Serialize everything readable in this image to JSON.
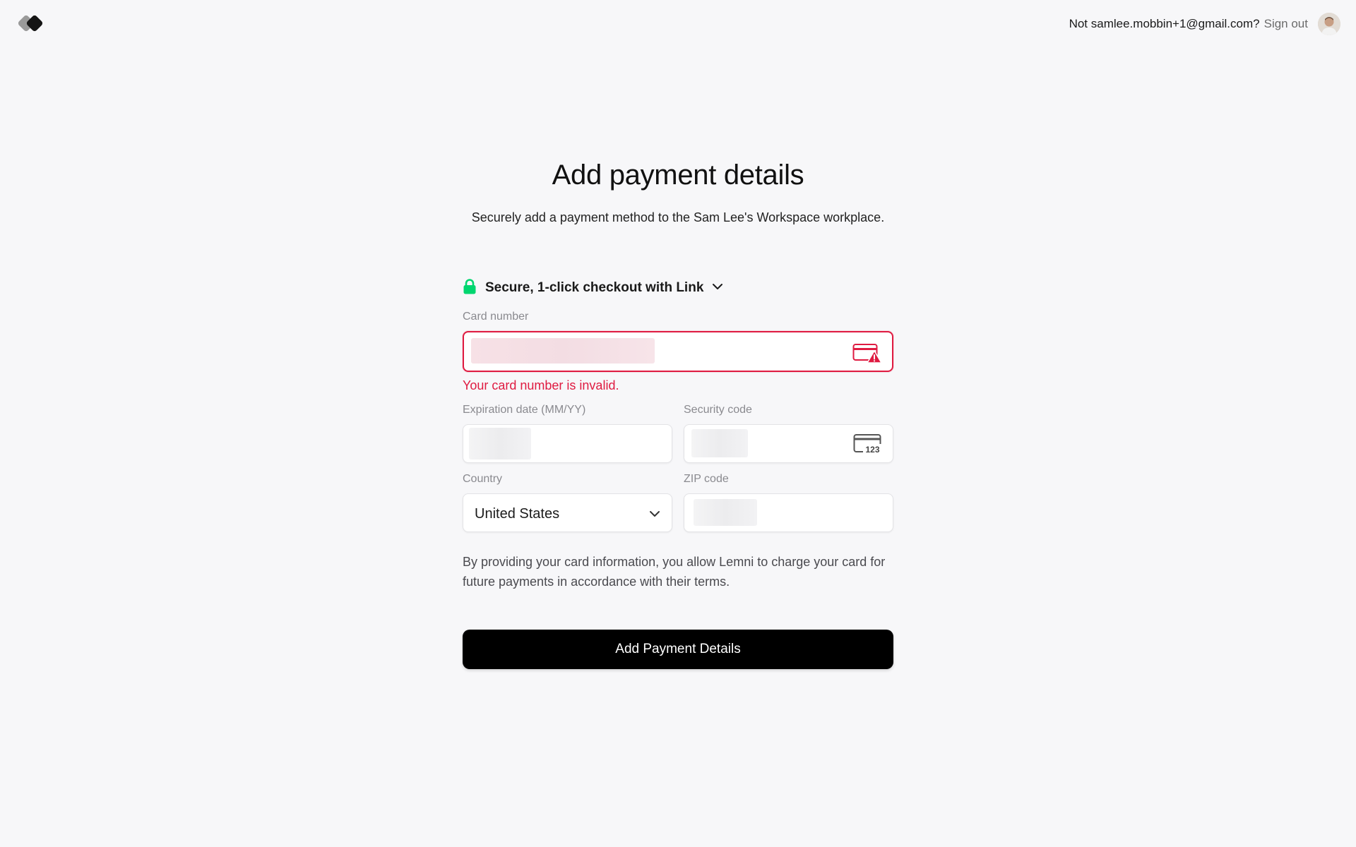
{
  "header": {
    "logo_icon": "brand-logo",
    "not_user_text": "Not samlee.mobbin+1@gmail.com?",
    "sign_out_label": "Sign out",
    "avatar_icon": "user-avatar"
  },
  "main": {
    "title": "Add payment details",
    "subtitle": "Securely add a payment method to the Sam Lee's Workspace workplace."
  },
  "payment_form": {
    "link_checkout": {
      "label": "Secure, 1-click checkout with Link",
      "lock_icon": "lock-icon",
      "chevron_icon": "chevron-down-icon",
      "accent_color": "#00d66f"
    },
    "card_number": {
      "label": "Card number",
      "value": "",
      "error": "Your card number is invalid.",
      "error_color": "#df1b41",
      "icon": "card-error-icon"
    },
    "expiration": {
      "label": "Expiration date (MM/YY)",
      "value": ""
    },
    "security_code": {
      "label": "Security code",
      "value": "",
      "icon": "cvc-card-icon",
      "icon_text": "123"
    },
    "country": {
      "label": "Country",
      "value": "United States",
      "icon": "chevron-down-icon"
    },
    "zip": {
      "label": "ZIP code",
      "value": ""
    },
    "terms": "By providing your card information, you allow Lemni to charge your card for future payments in accordance with their terms.",
    "submit_label": "Add Payment Details"
  }
}
